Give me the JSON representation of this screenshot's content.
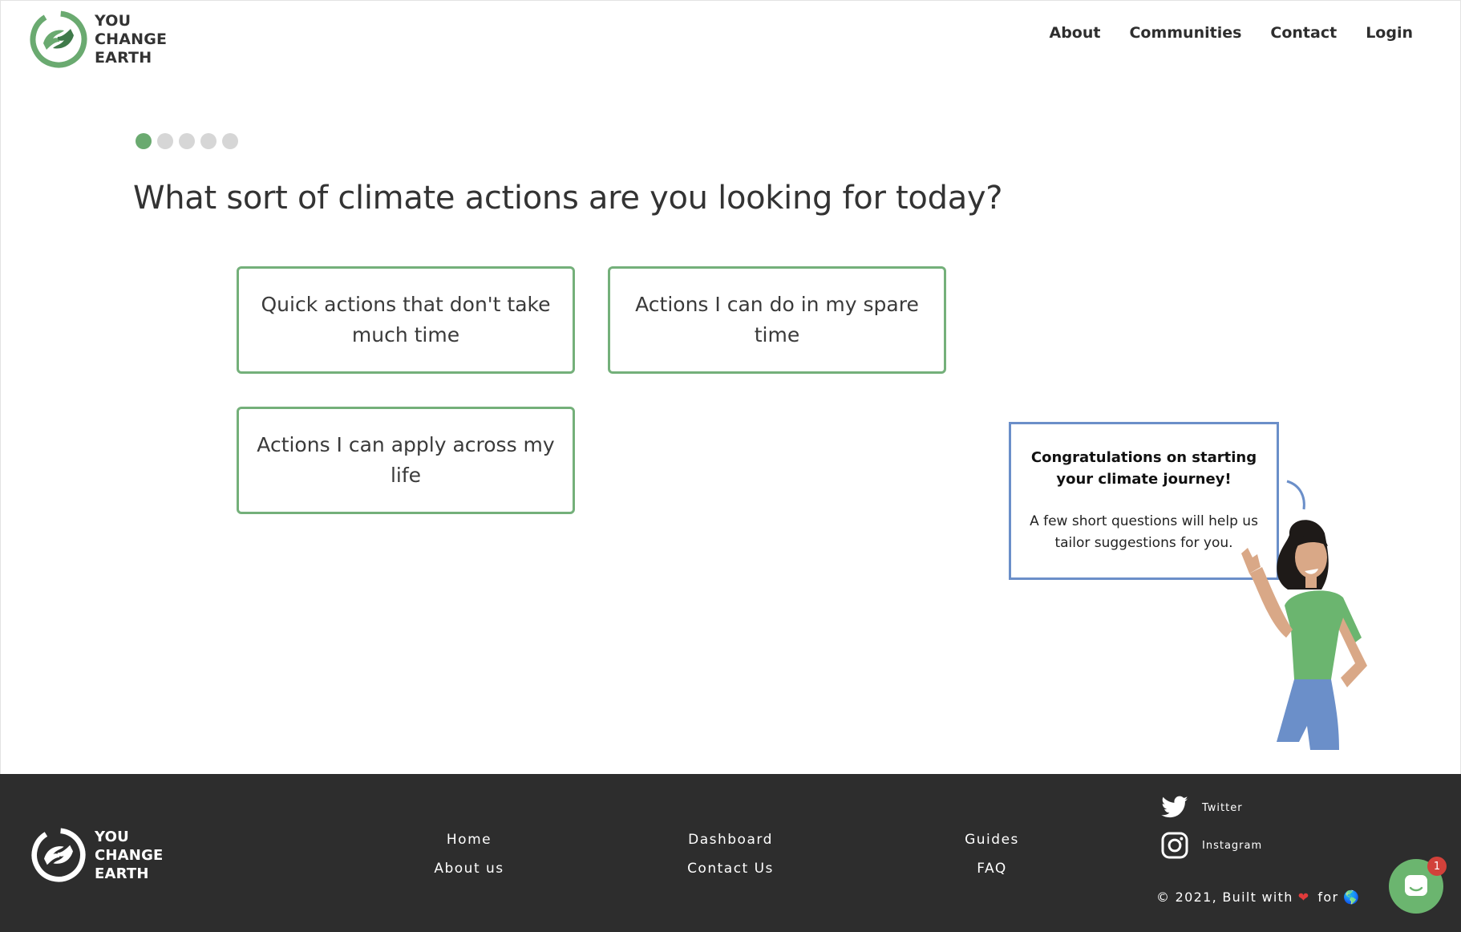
{
  "header": {
    "logo": {
      "line1": "YOU",
      "line2": "CHANGE",
      "line3": "EARTH",
      "icon": "hands-earth-logo"
    },
    "nav": [
      {
        "label": "About"
      },
      {
        "label": "Communities"
      },
      {
        "label": "Contact"
      },
      {
        "label": "Login"
      }
    ]
  },
  "progress": {
    "current_step": 1,
    "total_steps": 5
  },
  "question": {
    "title": "What sort of climate actions are you looking for today?",
    "options": [
      {
        "label": "Quick actions that don't take much time"
      },
      {
        "label": "Actions I can do in my spare time"
      },
      {
        "label": "Actions I can apply across my life"
      }
    ]
  },
  "bubble": {
    "title": "Congratulations on starting your climate journey!",
    "body": "A few short questions will help us tailor suggestions for you."
  },
  "footer": {
    "logo": {
      "line1": "YOU",
      "line2": "CHANGE",
      "line3": "EARTH"
    },
    "columns": [
      [
        {
          "label": "Home"
        },
        {
          "label": "About us"
        }
      ],
      [
        {
          "label": "Dashboard"
        },
        {
          "label": "Contact Us"
        }
      ],
      [
        {
          "label": "Guides"
        },
        {
          "label": "FAQ"
        }
      ]
    ],
    "social": [
      {
        "label": "Twitter",
        "icon": "twitter-icon"
      },
      {
        "label": "Instagram",
        "icon": "instagram-icon"
      }
    ],
    "copyright": {
      "prefix": "© 2021, Built with",
      "middle": "for",
      "heart": "❤",
      "globe": "🌎"
    }
  },
  "chat": {
    "badge_count": "1",
    "icon": "chat-icon"
  },
  "colors": {
    "brand_green": "#6aaa70",
    "option_border": "#74b07a",
    "bubble_border": "#6b8fc9",
    "footer_bg": "#2d2d2d",
    "badge_red": "#d2413a"
  }
}
